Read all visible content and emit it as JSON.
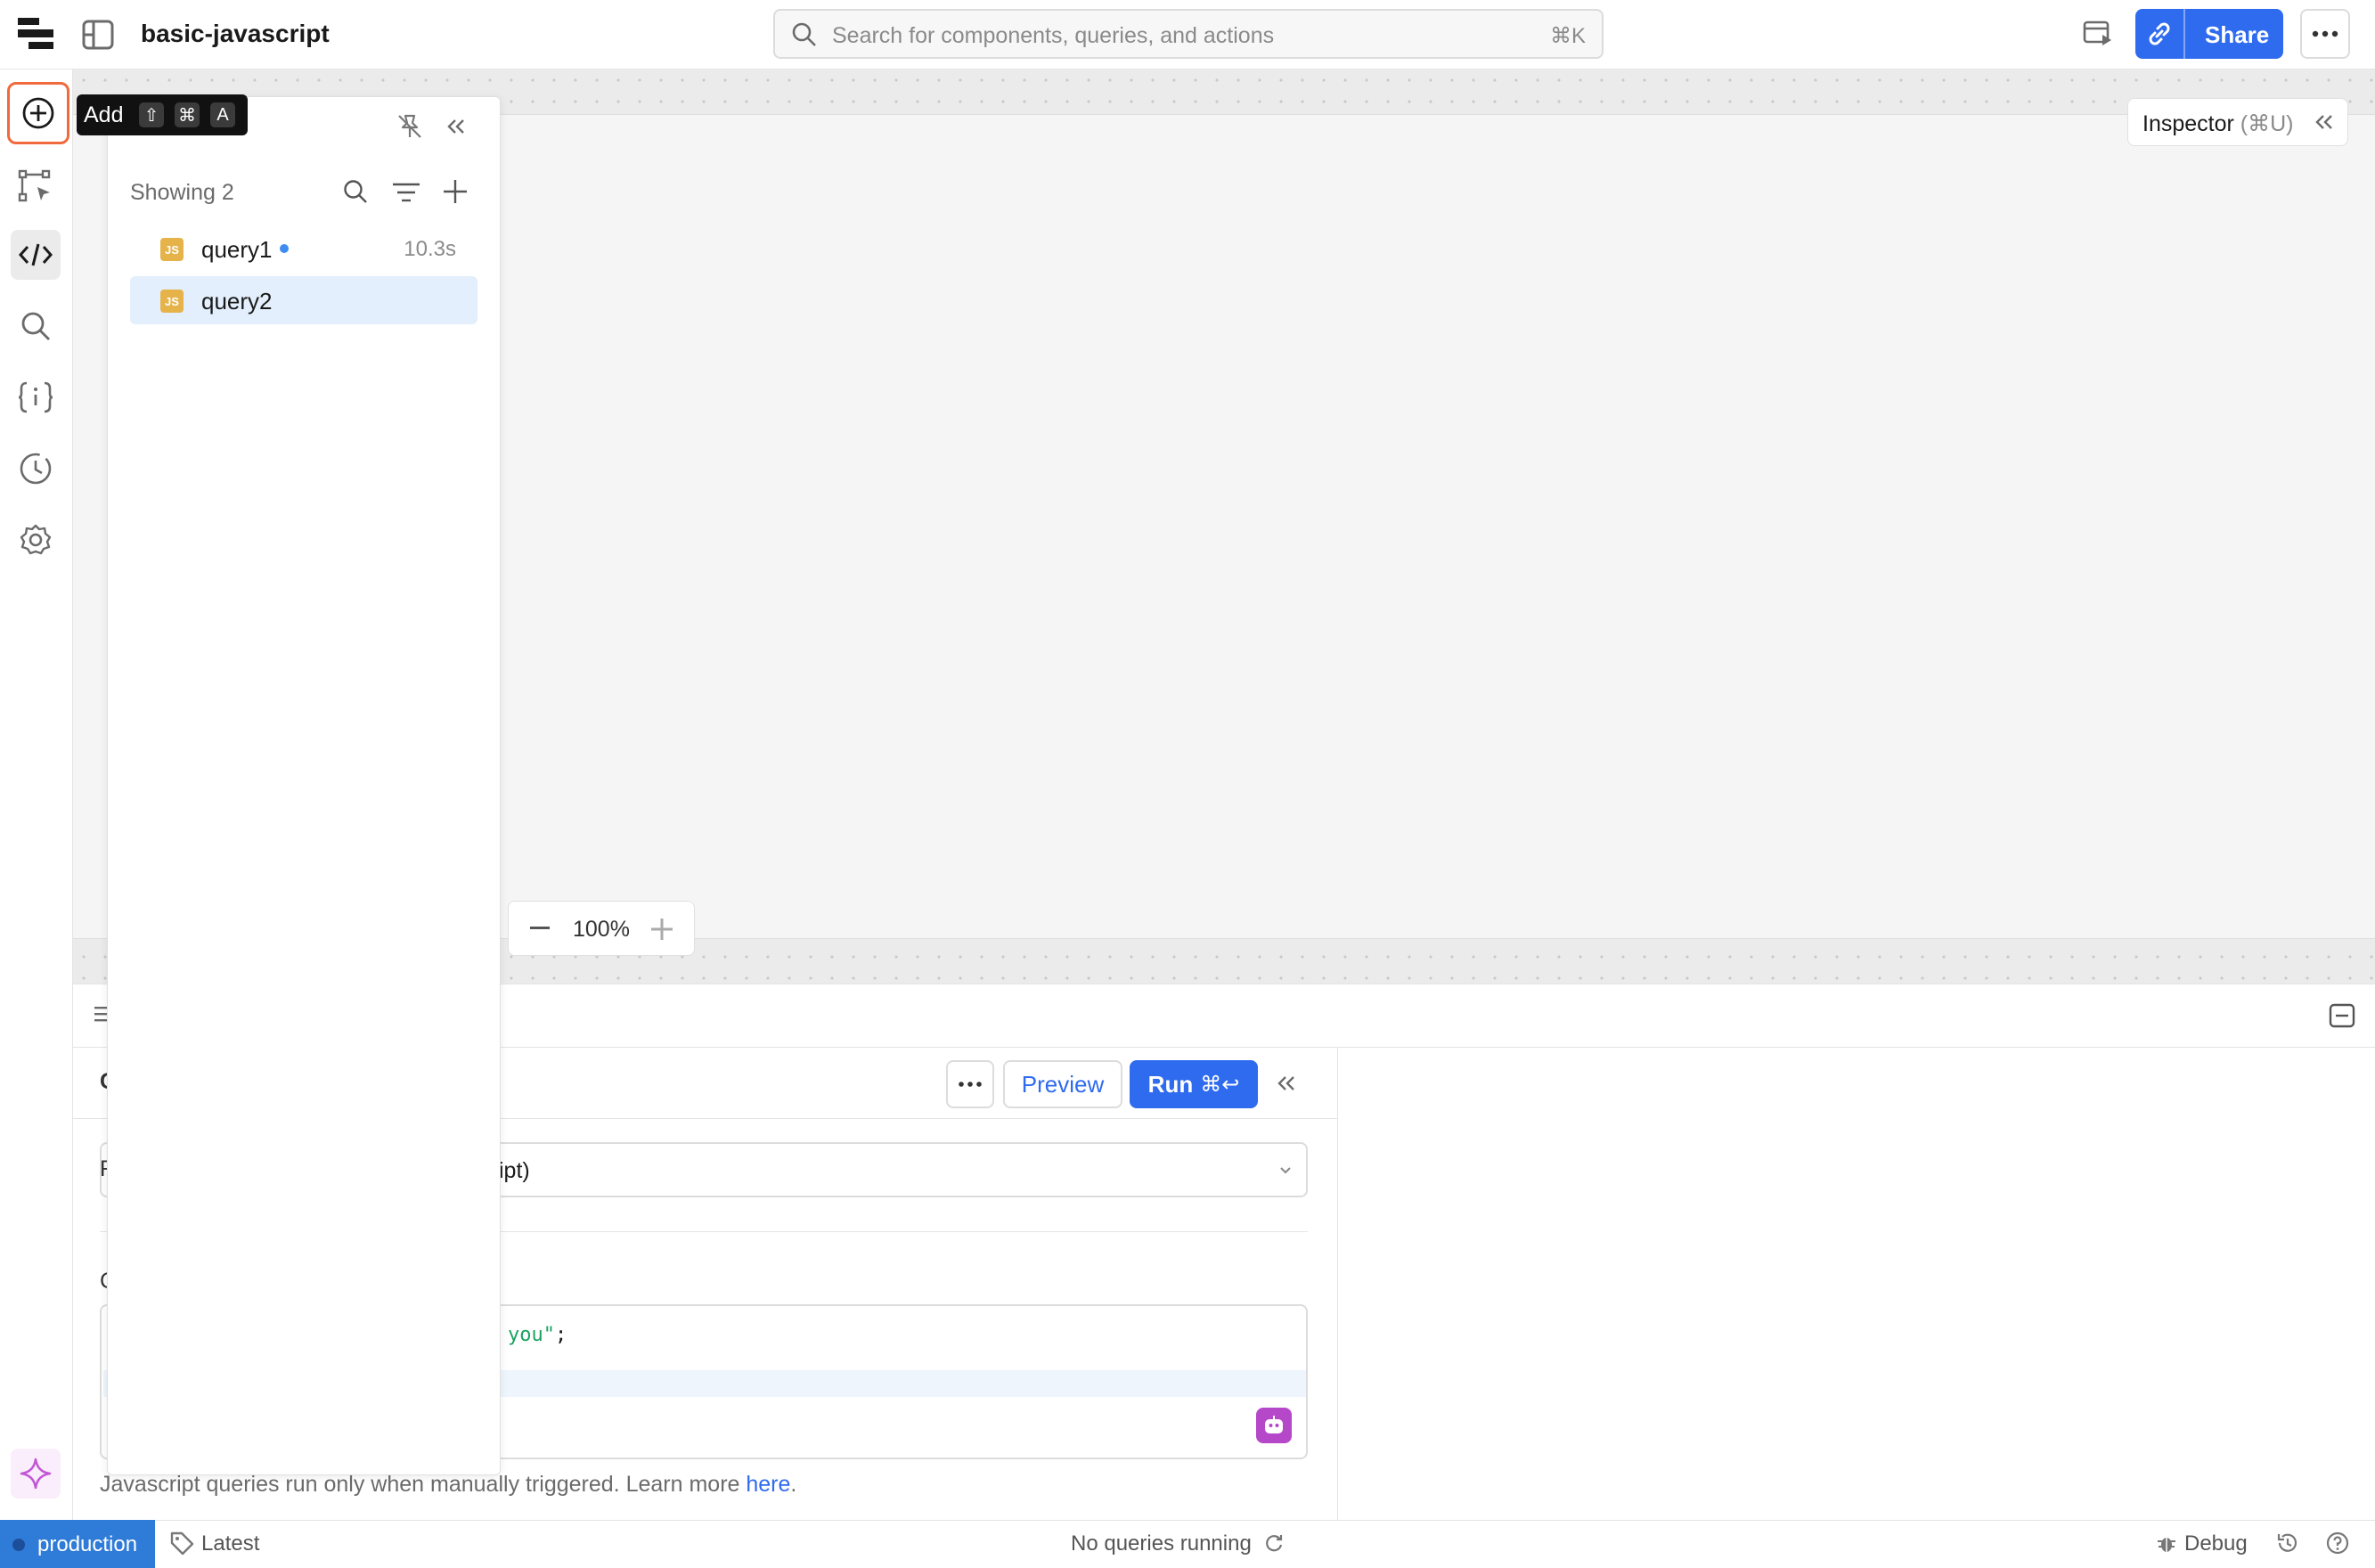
{
  "app": {
    "title": "basic-javascript"
  },
  "search": {
    "placeholder": "Search for components, queries, and actions",
    "shortcut": "⌘K"
  },
  "header": {
    "share_label": "Share"
  },
  "tooltip": {
    "label": "Add",
    "keys": [
      "⇧",
      "⌘",
      "A"
    ]
  },
  "query_list": {
    "showing": "Showing 2",
    "items": [
      {
        "name": "query1",
        "time": "10.3s",
        "type": "JS",
        "has_dot": true
      },
      {
        "name": "query2",
        "time": "",
        "type": "JS",
        "selected": true
      }
    ]
  },
  "inspector": {
    "label": "Inspector",
    "shortcut": "(⌘U)"
  },
  "zoom": {
    "value": "100%"
  },
  "query_editor": {
    "preview_label": "Preview",
    "run_label": "Run",
    "run_shortcut": "⌘↩",
    "resource_value": "ipt)",
    "code_fragment_str": "you\"",
    "code_fragment_end": ";",
    "help_text": "Javascript queries run only when manually triggered. Learn more ",
    "help_link": "here",
    "help_end": "."
  },
  "status_bar": {
    "environment": "production",
    "version": "Latest",
    "queries": "No queries running",
    "debug": "Debug"
  },
  "colors": {
    "accent": "#2f6bef",
    "environment": "#2f7bd8",
    "js_badge": "#e6b34a",
    "ai": "#b547c9",
    "highlight_outline": "#f06a3d"
  }
}
